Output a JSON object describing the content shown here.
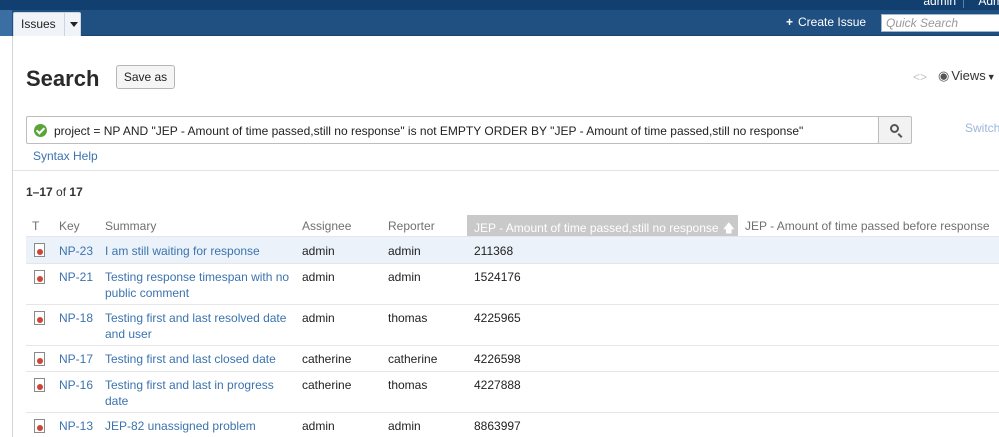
{
  "top": {
    "user": "admin",
    "admin_menu": "Adm"
  },
  "nav": {
    "issues_tab": "Issues",
    "create_issue": "Create Issue",
    "quick_search_placeholder": "Quick Search"
  },
  "header": {
    "title": "Search",
    "save_as": "Save as",
    "views": "Views"
  },
  "search": {
    "jql": "project = NP AND \"JEP - Amount of time passed,still no response\" is not EMPTY ORDER BY \"JEP - Amount of time passed,still no response\"",
    "switch": "Switch",
    "syntax_help": "Syntax Help"
  },
  "results": {
    "range": "1–17",
    "of": "of",
    "total": "17"
  },
  "columns": {
    "type": "T",
    "key": "Key",
    "summary": "Summary",
    "assignee": "Assignee",
    "reporter": "Reporter",
    "sorted": "JEP - Amount of time passed,still no response",
    "next": "JEP - Amount of time passed before response"
  },
  "rows": [
    {
      "key": "NP-23",
      "summary": "I am still waiting for response",
      "assignee": "admin",
      "reporter": "admin",
      "value": "211368"
    },
    {
      "key": "NP-21",
      "summary": "Testing response timespan with no public comment",
      "assignee": "admin",
      "reporter": "admin",
      "value": "1524176"
    },
    {
      "key": "NP-18",
      "summary": "Testing first and last resolved date and user",
      "assignee": "admin",
      "reporter": "thomas",
      "value": "4225965"
    },
    {
      "key": "NP-17",
      "summary": "Testing first and last closed date",
      "assignee": "catherine",
      "reporter": "catherine",
      "value": "4226598"
    },
    {
      "key": "NP-16",
      "summary": "Testing first and last in progress date",
      "assignee": "catherine",
      "reporter": "thomas",
      "value": "4227888"
    },
    {
      "key": "NP-13",
      "summary": "JEP-82 unassigned problem",
      "assignee": "admin",
      "reporter": "admin",
      "value": "8863997"
    }
  ],
  "colors": {
    "nav": "#205081",
    "link": "#3b73af",
    "sorted_header": "#c9c9c9",
    "selected_row": "#ebf2f9"
  },
  "icons": {
    "issue_type": "bug-icon",
    "search": "search-icon",
    "views": "eye-icon",
    "ok": "check-circle-icon"
  }
}
